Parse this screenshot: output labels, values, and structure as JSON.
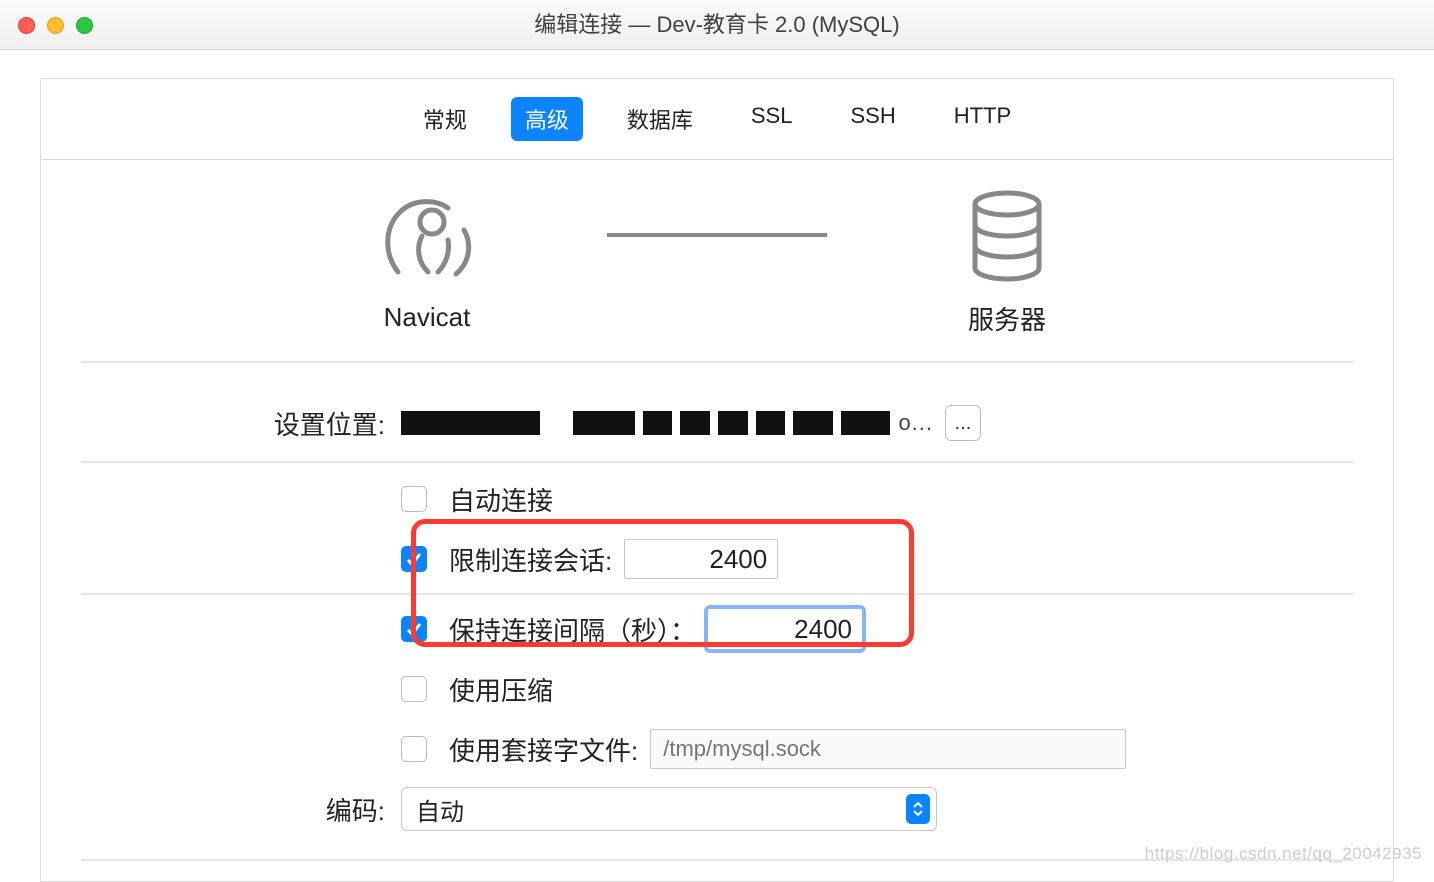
{
  "window": {
    "title": "编辑连接 — Dev-教育卡 2.0 (MySQL)"
  },
  "tabs": [
    {
      "label": "常规",
      "active": false
    },
    {
      "label": "高级",
      "active": true
    },
    {
      "label": "数据库",
      "active": false
    },
    {
      "label": "SSL",
      "active": false
    },
    {
      "label": "SSH",
      "active": false
    },
    {
      "label": "HTTP",
      "active": false
    }
  ],
  "diagram": {
    "client_label": "Navicat",
    "server_label": "服务器"
  },
  "settings": {
    "location_label": "设置位置:",
    "location_path_suffix": "o...",
    "browse_label": "..."
  },
  "options": {
    "auto_connect": {
      "label": "自动连接",
      "checked": false
    },
    "limit_sessions": {
      "label": "限制连接会话:",
      "checked": true,
      "value": "2400"
    },
    "keepalive": {
      "label": "保持连接间隔（秒）：",
      "checked": true,
      "value": "2400"
    },
    "use_compression": {
      "label": "使用压缩",
      "checked": false
    },
    "use_socket": {
      "label": "使用套接字文件:",
      "checked": false,
      "placeholder": "/tmp/mysql.sock"
    }
  },
  "encoding": {
    "label": "编码:",
    "value": "自动"
  },
  "watermark": "https://blog.csdn.net/qq_20042935"
}
